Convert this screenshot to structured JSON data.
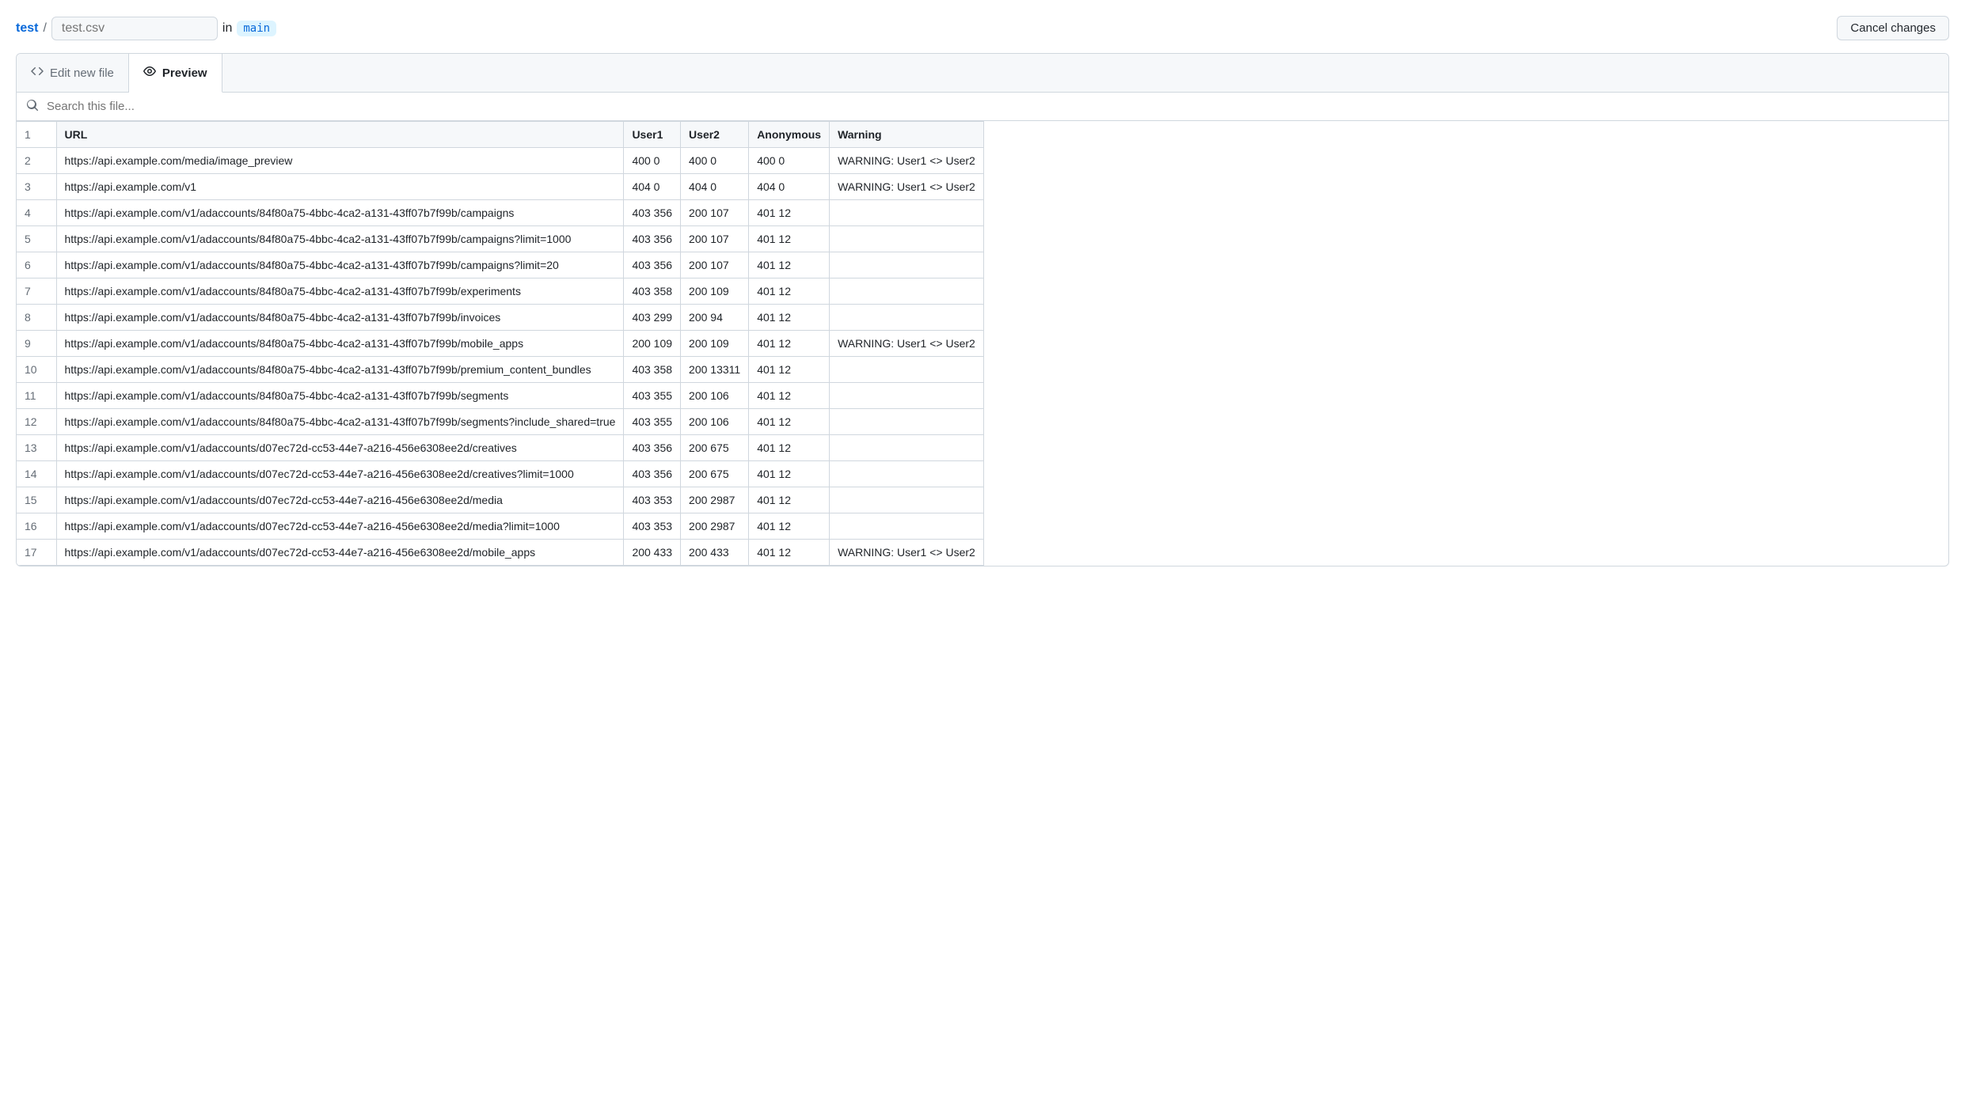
{
  "breadcrumb": {
    "root": "test",
    "filename_placeholder": "test.csv",
    "in_label": "in",
    "branch": "main"
  },
  "buttons": {
    "cancel": "Cancel changes"
  },
  "tabs": {
    "edit": "Edit new file",
    "preview": "Preview"
  },
  "search": {
    "placeholder": "Search this file..."
  },
  "table": {
    "headers": [
      "URL",
      "User1",
      "User2",
      "Anonymous",
      "Warning"
    ],
    "rows": [
      {
        "n": 1
      },
      {
        "n": 2,
        "url": "https://api.example.com/media/image_preview",
        "user1": "400 0",
        "user2": "400 0",
        "anonymous": "400 0",
        "warning": "WARNING: User1 <> User2"
      },
      {
        "n": 3,
        "url": "https://api.example.com/v1",
        "user1": "404 0",
        "user2": "404 0",
        "anonymous": "404 0",
        "warning": "WARNING: User1 <> User2"
      },
      {
        "n": 4,
        "url": "https://api.example.com/v1/adaccounts/84f80a75-4bbc-4ca2-a131-43ff07b7f99b/campaigns",
        "user1": "403 356",
        "user2": "200 107",
        "anonymous": "401 12",
        "warning": ""
      },
      {
        "n": 5,
        "url": "https://api.example.com/v1/adaccounts/84f80a75-4bbc-4ca2-a131-43ff07b7f99b/campaigns?limit=1000",
        "user1": "403 356",
        "user2": "200 107",
        "anonymous": "401 12",
        "warning": ""
      },
      {
        "n": 6,
        "url": "https://api.example.com/v1/adaccounts/84f80a75-4bbc-4ca2-a131-43ff07b7f99b/campaigns?limit=20",
        "user1": "403 356",
        "user2": "200 107",
        "anonymous": "401 12",
        "warning": ""
      },
      {
        "n": 7,
        "url": "https://api.example.com/v1/adaccounts/84f80a75-4bbc-4ca2-a131-43ff07b7f99b/experiments",
        "user1": "403 358",
        "user2": "200 109",
        "anonymous": "401 12",
        "warning": ""
      },
      {
        "n": 8,
        "url": "https://api.example.com/v1/adaccounts/84f80a75-4bbc-4ca2-a131-43ff07b7f99b/invoices",
        "user1": "403 299",
        "user2": "200 94",
        "anonymous": "401 12",
        "warning": ""
      },
      {
        "n": 9,
        "url": "https://api.example.com/v1/adaccounts/84f80a75-4bbc-4ca2-a131-43ff07b7f99b/mobile_apps",
        "user1": "200 109",
        "user2": "200 109",
        "anonymous": "401 12",
        "warning": "WARNING: User1 <> User2"
      },
      {
        "n": 10,
        "url": "https://api.example.com/v1/adaccounts/84f80a75-4bbc-4ca2-a131-43ff07b7f99b/premium_content_bundles",
        "user1": "403 358",
        "user2": "200 13311",
        "anonymous": "401 12",
        "warning": ""
      },
      {
        "n": 11,
        "url": "https://api.example.com/v1/adaccounts/84f80a75-4bbc-4ca2-a131-43ff07b7f99b/segments",
        "user1": "403 355",
        "user2": "200 106",
        "anonymous": "401 12",
        "warning": ""
      },
      {
        "n": 12,
        "url": "https://api.example.com/v1/adaccounts/84f80a75-4bbc-4ca2-a131-43ff07b7f99b/segments?include_shared=true",
        "user1": "403 355",
        "user2": "200 106",
        "anonymous": "401 12",
        "warning": ""
      },
      {
        "n": 13,
        "url": "https://api.example.com/v1/adaccounts/d07ec72d-cc53-44e7-a216-456e6308ee2d/creatives",
        "user1": "403 356",
        "user2": "200 675",
        "anonymous": "401 12",
        "warning": ""
      },
      {
        "n": 14,
        "url": "https://api.example.com/v1/adaccounts/d07ec72d-cc53-44e7-a216-456e6308ee2d/creatives?limit=1000",
        "user1": "403 356",
        "user2": "200 675",
        "anonymous": "401 12",
        "warning": ""
      },
      {
        "n": 15,
        "url": "https://api.example.com/v1/adaccounts/d07ec72d-cc53-44e7-a216-456e6308ee2d/media",
        "user1": "403 353",
        "user2": "200 2987",
        "anonymous": "401 12",
        "warning": ""
      },
      {
        "n": 16,
        "url": "https://api.example.com/v1/adaccounts/d07ec72d-cc53-44e7-a216-456e6308ee2d/media?limit=1000",
        "user1": "403 353",
        "user2": "200 2987",
        "anonymous": "401 12",
        "warning": ""
      },
      {
        "n": 17,
        "url": "https://api.example.com/v1/adaccounts/d07ec72d-cc53-44e7-a216-456e6308ee2d/mobile_apps",
        "user1": "200 433",
        "user2": "200 433",
        "anonymous": "401 12",
        "warning": "WARNING: User1 <> User2"
      }
    ]
  }
}
